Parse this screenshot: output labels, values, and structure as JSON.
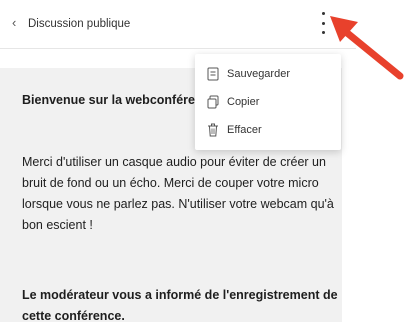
{
  "header": {
    "back_icon": "chevron-left-icon",
    "title": "Discussion publique",
    "menu_icon": "kebab-menu-icon"
  },
  "dropdown": {
    "items": [
      {
        "label": "Sauvegarder",
        "icon": "save-icon"
      },
      {
        "label": "Copier",
        "icon": "copy-icon"
      },
      {
        "label": "Effacer",
        "icon": "trash-icon"
      }
    ]
  },
  "chat": {
    "welcome": "Bienvenue sur la webconférence Open !",
    "info": "Merci d'utiliser un casque audio pour éviter de créer un bruit de fond ou un écho. Merci de couper votre micro lorsque vous ne parlez pas. N'utiliser votre webcam qu'à bon escient !",
    "recording": "Le modérateur vous a informé de l'enregistrement de cette conférence."
  },
  "annotation": {
    "arrow_color": "#e8412c"
  }
}
